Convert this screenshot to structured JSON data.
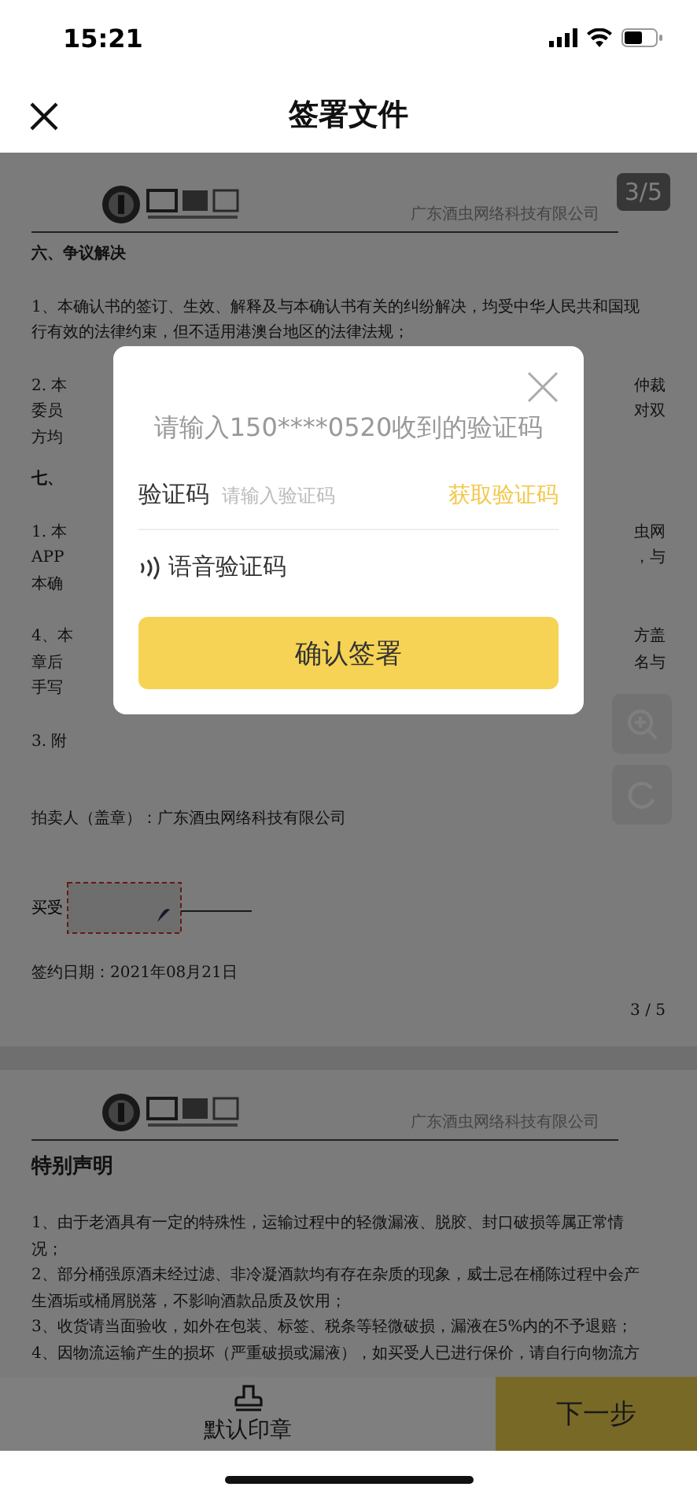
{
  "status_bar": {
    "time": "15:21"
  },
  "nav": {
    "title": "签署文件"
  },
  "pages": [
    {
      "company": "广东酒虫网络科技有限公司",
      "page_badge": "3/5",
      "blocks": [
        {
          "kind": "heading",
          "lines": [
            {
              "left": "六、争议解决"
            }
          ]
        },
        {
          "kind": "para",
          "lines": [
            {
              "left": "1、本确认书的签订、生效、解释及与本确认书有关的纠纷解决，均受中华人民共和国现"
            },
            {
              "left": "行有效的法律约束，但不适用港澳台地区的法律法规；"
            }
          ]
        },
        {
          "kind": "para",
          "lines": [
            {
              "left": "2. 本",
              "right": "仲裁"
            },
            {
              "left": "委员",
              "right": "对双"
            },
            {
              "left": "方均"
            }
          ]
        },
        {
          "kind": "heading",
          "lines": [
            {
              "left": "七、"
            }
          ]
        },
        {
          "kind": "para",
          "lines": [
            {
              "left": "1. 本",
              "right": "虫网"
            },
            {
              "left": "APP",
              "right": "，与"
            },
            {
              "left": "本确"
            }
          ]
        },
        {
          "kind": "para",
          "lines": [
            {
              "left": "4、本",
              "right": "方盖"
            },
            {
              "left": "章后",
              "right": "名与"
            },
            {
              "left": "手写"
            }
          ]
        },
        {
          "kind": "para",
          "lines": [
            {
              "left": "3. 附"
            }
          ]
        },
        {
          "kind": "seller",
          "lines": [
            {
              "left": "拍卖人（盖章）：广东酒虫网络科技有限公司"
            }
          ]
        },
        {
          "kind": "signature",
          "lines": [
            {
              "left": "买受"
            }
          ]
        },
        {
          "kind": "para",
          "lines": [
            {
              "left": "签约日期：2021年08月21日"
            }
          ]
        },
        {
          "kind": "pagenum",
          "lines": [
            {
              "left": "3 / 5"
            }
          ]
        }
      ]
    },
    {
      "company": "广东酒虫网络科技有限公司",
      "blocks": [
        {
          "kind": "title",
          "lines": [
            {
              "left": "特别声明"
            }
          ]
        },
        {
          "kind": "para",
          "lines": [
            {
              "left": "1、由于老酒具有一定的特殊性，运输过程中的轻微漏液、脱胶、封口破损等属正常情"
            },
            {
              "left": "况；"
            },
            {
              "left": "2、部分桶强原酒未经过滤、非冷凝酒款均有存在杂质的现象，威士忌在桶陈过程中会产"
            },
            {
              "left": "生酒垢或桶屑脱落，不影响酒款品质及饮用；"
            },
            {
              "left": "3、收货请当面验收，如外在包装、标签、税条等轻微破损，漏液在5%内的不予退赔；"
            },
            {
              "left": "4、因物流运输产生的损坏（严重破损或漏液），如买受人已进行保价，请自行向物流方"
            }
          ]
        }
      ]
    }
  ],
  "modal": {
    "title": "请输入150****0520收到的验证码",
    "field_label": "验证码",
    "placeholder": "请输入验证码",
    "get_code": "获取验证码",
    "voice": "语音验证码",
    "confirm": "确认签署"
  },
  "bottom_bar": {
    "stamp": "默认印章",
    "next": "下一步"
  }
}
